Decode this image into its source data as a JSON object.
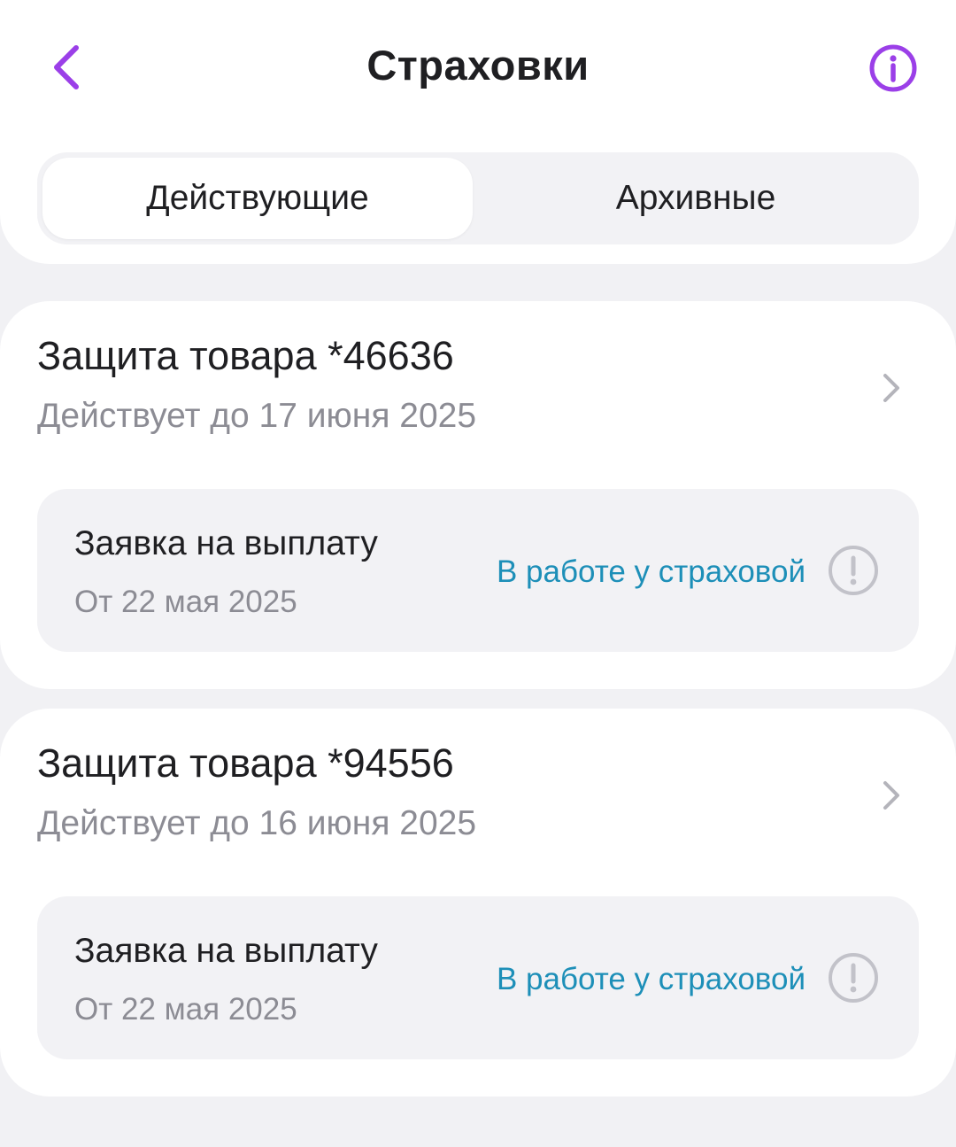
{
  "header": {
    "title": "Страховки",
    "back_icon": "chevron-left-icon",
    "info_icon": "info-icon",
    "accent_color": "#9b3fe8"
  },
  "tabs": [
    {
      "label": "Действующие",
      "active": true
    },
    {
      "label": "Архивные",
      "active": false
    }
  ],
  "policies": [
    {
      "title": "Защита товара *46636",
      "valid_until": "Действует до 17 июня 2025",
      "claim": {
        "title": "Заявка на выплату",
        "date": "От 22 мая 2025",
        "status": "В работе у страховой",
        "status_color": "#1d8fb8",
        "status_icon": "alert-circle-icon"
      }
    },
    {
      "title": "Защита товара *94556",
      "valid_until": "Действует до 16 июня 2025",
      "claim": {
        "title": "Заявка на выплату",
        "date": "От 22 мая 2025",
        "status": "В работе у страховой",
        "status_color": "#1d8fb8",
        "status_icon": "alert-circle-icon"
      }
    }
  ]
}
